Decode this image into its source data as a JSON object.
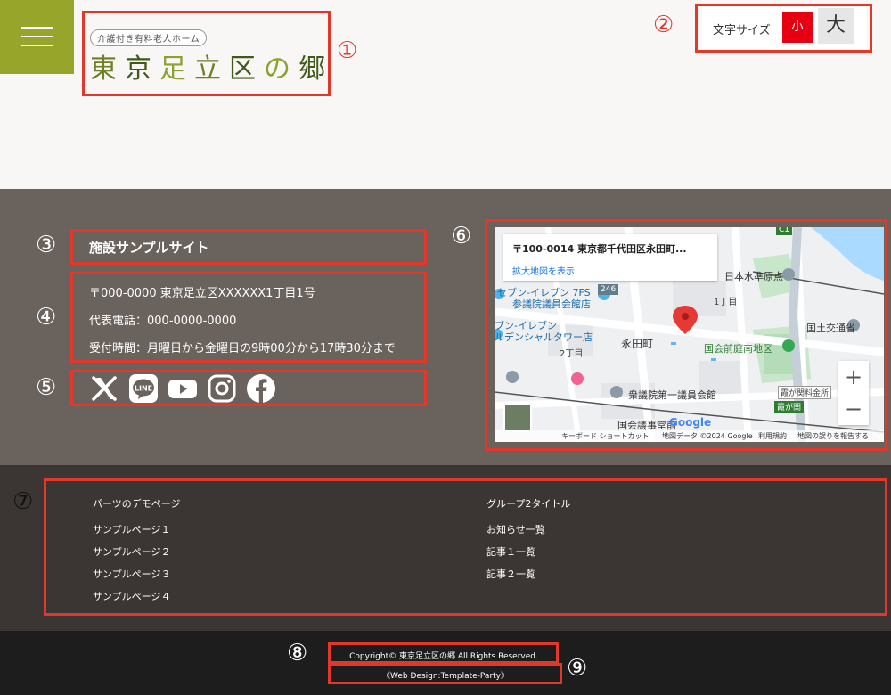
{
  "header": {
    "logo_sub": "介護付き有料老人ホーム",
    "logo_chars": [
      "東",
      "京",
      "足",
      "立",
      "区",
      "の",
      "郷"
    ],
    "fontsize_label": "文字サイズ",
    "fontsize_small": "小",
    "fontsize_large": "大"
  },
  "annotations": [
    "①",
    "②",
    "③",
    "④",
    "⑤",
    "⑥",
    "⑦",
    "⑧",
    "⑨"
  ],
  "info": {
    "facility_name": "施設サンプルサイト",
    "address": "〒000-0000 東京足立区XXXXXX1丁目1号",
    "phone": "代表電話：000-0000-0000",
    "hours": "受付時間：月曜日から金曜日の9時00分から17時30分まで",
    "social_icons": [
      "x-icon",
      "line-icon",
      "youtube-icon",
      "instagram-icon",
      "facebook-icon"
    ],
    "line_text": "LINE"
  },
  "map": {
    "card_address": "〒100-0014 東京都千代田区永田町...",
    "card_link": "拡大地図を表示",
    "labels": {
      "seven1": "セブン-イレブン 7FS",
      "seven1b": "参議院議員会館店",
      "seven2": "ブン-イレブン",
      "seven2b": "ルデンシャルタワー店",
      "nagatacho": "永田町",
      "itchome": "1丁目",
      "nichome": "2丁目",
      "kokkai_south": "国会前庭南地区",
      "kokudo": "国土交通省",
      "shugiin": "衆議院第一議員会館",
      "kokkai_jido": "国会議事堂前",
      "kasumigaseki_note": "霞が関料金所",
      "kasumigaseki": "霞が関",
      "nippon_suijun": "日本水準原点",
      "route": "246",
      "badge_c1": "C1"
    },
    "footer": {
      "shortcuts": "キーボード ショートカット",
      "mapdata": "地図データ ©2024 Google",
      "terms": "利用規約",
      "report": "地図の誤りを報告する"
    },
    "zoom_in": "+",
    "zoom_out": "−",
    "google": "Google"
  },
  "nav": {
    "col1_title": "パーツのデモページ",
    "col1_items": [
      "サンプルページ１",
      "サンプルページ２",
      "サンプルページ３",
      "サンプルページ４"
    ],
    "col2_title": "グループ2タイトル",
    "col2_items": [
      "お知らせ一覧",
      "記事１一覧",
      "記事２一覧"
    ]
  },
  "footer": {
    "copyright": "Copyright© 東京足立区の郷 All Rights Reserved.",
    "credit": "《Web Design:Template-Party》"
  },
  "colors": {
    "accent_green": "#97a52a",
    "annotation_red": "#e0382b",
    "fontsize_active": "#e60012"
  }
}
